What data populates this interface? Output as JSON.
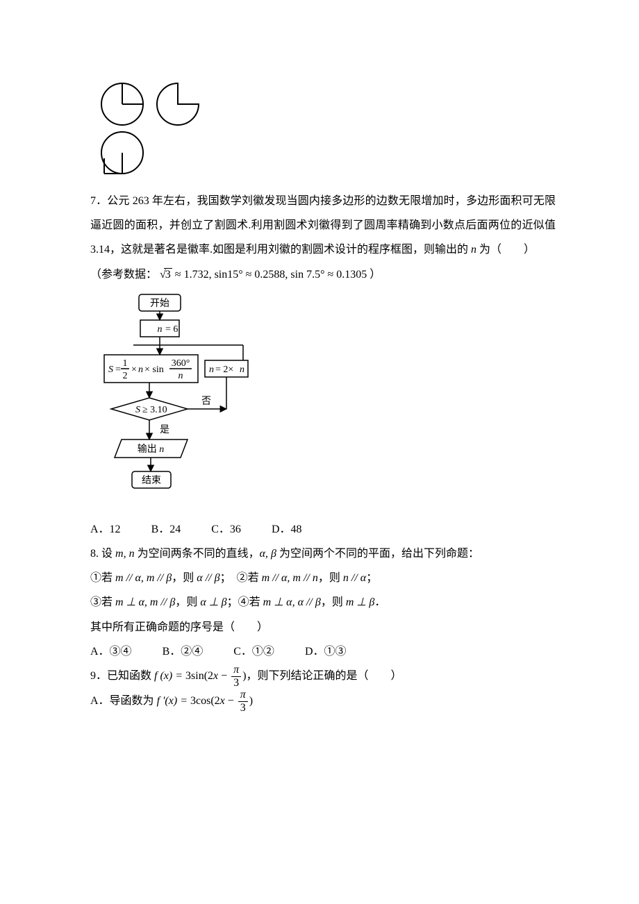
{
  "top_diagram": {
    "shape1": "circle-q1-lines",
    "shape2": "circle-q1-missing",
    "shape3": "circle-q3-square"
  },
  "q7": {
    "num": "7．",
    "text_part1": "公元 263 年左右，我国数学刘徽发现当圆内接多边形的边数无限增加时，多边形面积可无限逼近圆的面积，并创立了割圆术.利用割圆术刘徽得到了圆周率精确到小数点后面两位的近似值 3.14，这就是著名是徽率.如图是利用刘徽的割圆术设计的程序框图，则输出的 ",
    "text_part2": " 为（　　）",
    "ref_label": "（参考数据：",
    "ref_tail": "）",
    "ref_math": "√3 ≈ 1.732, sin15° ≈ 0.2588, sin7.5° ≈ 0.1305",
    "options": {
      "A": "A．12",
      "B": "B．24",
      "C": "C．36",
      "D": "D．48"
    }
  },
  "flowchart": {
    "start": "开始",
    "init": "n = 6",
    "formula_prefix": "S =",
    "half_top": "1",
    "half_bot": "2",
    "times1": "× n × sin",
    "deg_top": "360°",
    "deg_bot": "n",
    "update": "n = 2 × n",
    "cond": "S ≥ 3.10",
    "no": "否",
    "yes": "是",
    "output": "输出 n",
    "end": "结束"
  },
  "q8": {
    "num": "8. ",
    "text_lead": "设 ",
    "text_mid1": " 为空间两条不同的直线，",
    "text_mid2": " 为空间两个不同的平面，给出下列命题：",
    "p1a": "①若 ",
    "p1b": "，则 ",
    "p1c": "；　②若 ",
    "p1d": "，则 ",
    "p1e": "；",
    "p3a": "③若 ",
    "p3b": "，则 ",
    "p3c": "；④若 ",
    "p3d": "，则 ",
    "p3e": "．",
    "tail": "其中所有正确命题的序号是（　　）",
    "options": {
      "A": "A．③④",
      "B": "B．②④",
      "C": "C．①②",
      "D": "D．①③"
    }
  },
  "q9": {
    "num": "9．",
    "lead": "已知函数 ",
    "tail": "，则下列结论正确的是（　　）",
    "optA_lead": "A．导函数为 "
  },
  "chart_data": {
    "type": "flowchart",
    "title": "割圆术程序框图",
    "nodes": [
      {
        "id": "start",
        "type": "terminal",
        "label": "开始"
      },
      {
        "id": "init",
        "type": "process",
        "label": "n = 6"
      },
      {
        "id": "calc",
        "type": "process",
        "label": "S = (1/2) × n × sin(360°/n)"
      },
      {
        "id": "cond",
        "type": "decision",
        "label": "S ≥ 3.10"
      },
      {
        "id": "update",
        "type": "process",
        "label": "n = 2 × n"
      },
      {
        "id": "out",
        "type": "io",
        "label": "输出 n"
      },
      {
        "id": "end",
        "type": "terminal",
        "label": "结束"
      }
    ],
    "edges": [
      {
        "from": "start",
        "to": "init"
      },
      {
        "from": "init",
        "to": "calc"
      },
      {
        "from": "calc",
        "to": "cond"
      },
      {
        "from": "cond",
        "to": "out",
        "label": "是"
      },
      {
        "from": "cond",
        "to": "update",
        "label": "否"
      },
      {
        "from": "update",
        "to": "calc"
      },
      {
        "from": "out",
        "to": "end"
      }
    ],
    "reference_values": {
      "sqrt3": 1.732,
      "sin15deg": 0.2588,
      "sin7_5deg": 0.1305
    }
  }
}
